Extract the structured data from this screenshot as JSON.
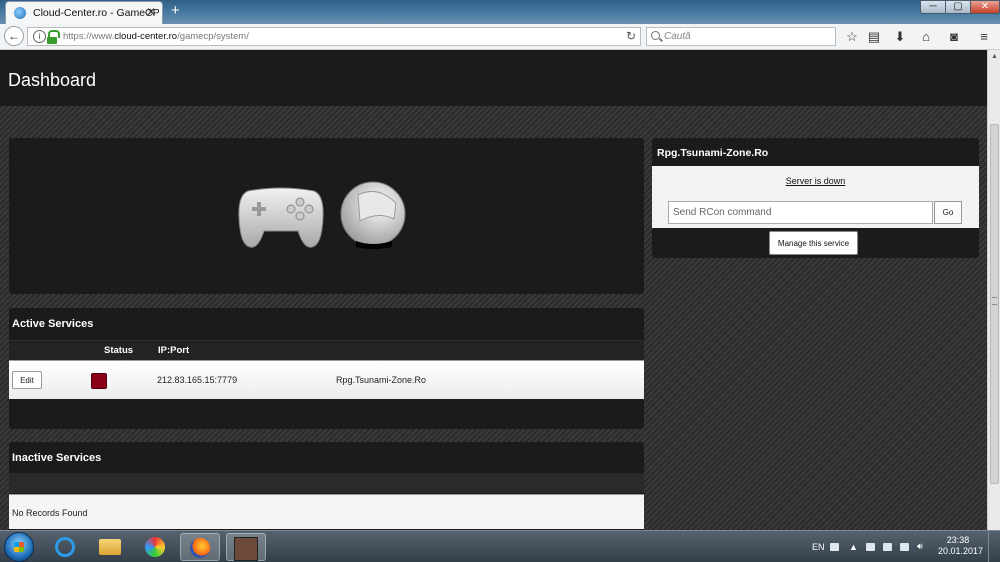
{
  "browser": {
    "tab_title": "Cloud-Center.ro - GameCP",
    "tab_close": "✕",
    "new_tab": "+",
    "url_prefix": "https://www.",
    "url_domain": "cloud-center.ro",
    "url_path": "/gamecp/system/",
    "search_placeholder": "Caută",
    "window_controls": [
      "─",
      "▢",
      "✕"
    ]
  },
  "page": {
    "title": "Dashboard"
  },
  "active_services": {
    "title": "Active Services",
    "columns": [
      "Status",
      "IP:Port"
    ],
    "rows": [
      {
        "edit_label": "Edit",
        "status_color": "#8b0019",
        "ip_port": "212.83.165.15:7779",
        "name": "Rpg.Tsunami-Zone.Ro"
      }
    ]
  },
  "inactive_services": {
    "title": "Inactive Services",
    "empty_text": "No Records Found"
  },
  "server_panel": {
    "title": "Rpg.Tsunami-Zone.Ro",
    "status": "Server is down",
    "rcon_placeholder": "Send RCon command",
    "go_label": "Go",
    "manage_label": "Manage this service"
  },
  "taskbar": {
    "language": "EN",
    "time": "23:38",
    "date": "20.01.2017"
  },
  "colors": {
    "accent_status_down": "#8b0019",
    "panel_bg": "#1b1b1b"
  }
}
